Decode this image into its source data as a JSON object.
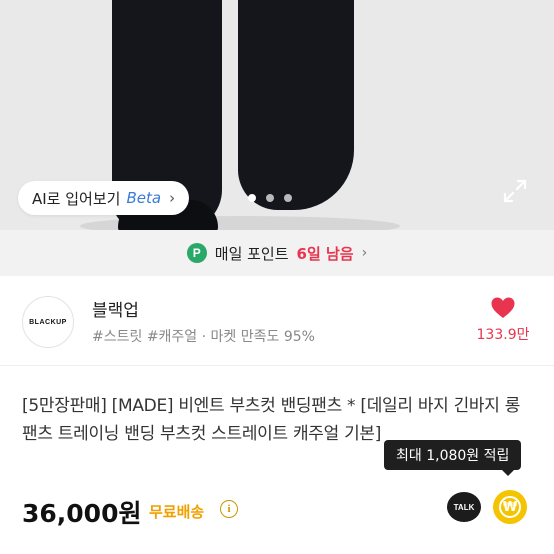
{
  "ai_try": {
    "label": "AI로 입어보기",
    "beta": "Beta",
    "chevron": "›"
  },
  "carousel": {
    "count": 3,
    "active": 0
  },
  "icons": {
    "expand": "expand-icon",
    "like": "heart-icon",
    "info": "info-icon",
    "talk": "kakaotalk-icon",
    "reward": "won-coin-icon"
  },
  "points_banner": {
    "badge": "P",
    "label": "매일 포인트",
    "days": "6일 남음",
    "arrow": "›"
  },
  "shop": {
    "logo_text": "BLACKUP",
    "name": "블랙업",
    "tags": "#스트릿 #캐주얼 · 마켓 만족도 95%",
    "like_count": "133.9만"
  },
  "product": {
    "title": "[5만장판매] [MADE] 비엔트 부츠컷 밴딩팬츠 * [데일리 바지 긴바지 롱팬츠 트레이닝 밴딩 부츠컷 스트레이트 캐주얼 기본]",
    "tooltip": "최대 1,080원 적립",
    "price": "36,000원",
    "shipping": "무료배송",
    "info_glyph": "i",
    "talk_label": "TALK",
    "won_glyph": "₩"
  },
  "colors": {
    "accent_red": "#e8344e",
    "point_green": "#2aa86a",
    "shipping_orange": "#f0a000",
    "coin_yellow": "#f5c400"
  }
}
